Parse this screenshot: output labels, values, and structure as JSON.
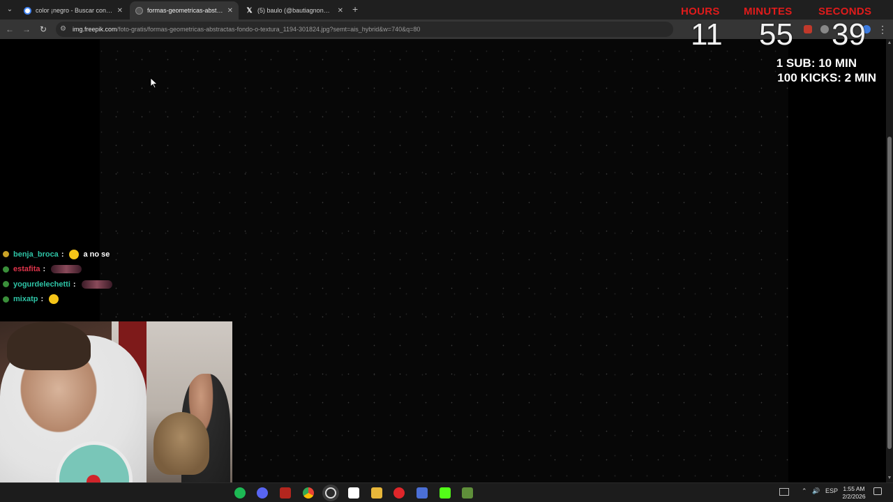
{
  "browser": {
    "tabs": [
      {
        "title": "color ¡negro - Buscar con Google",
        "favicon": "google-icon",
        "active": false
      },
      {
        "title": "formas-geometricas-abstractas-fondo-o-textura",
        "favicon": "freepik-icon",
        "active": true
      },
      {
        "title": "(5) baulo (@bautiagnone) / X",
        "favicon": "x-icon",
        "active": false
      }
    ],
    "new_tab_symbol": "+",
    "url_host": "img.freepik.com",
    "url_path": "/foto-gratis/formas-geometricas-abstractas-fondo-o-textura_1194-301824.jpg?semt=ais_hybrid&w=740&q=80",
    "nav": {
      "back": "←",
      "forward": "→",
      "reload": "↻"
    }
  },
  "stream_overlay": {
    "timer": {
      "labels": {
        "hours": "HOURS",
        "minutes": "MINUTES",
        "seconds": "SECONDS"
      },
      "hours": "11",
      "minutes": "55",
      "seconds": "39",
      "label_color": "#e11b1b"
    },
    "rules": [
      "1 SUB: 10 MIN",
      "100 KICKS: 2 MIN"
    ]
  },
  "chat": [
    {
      "user": "benja_broca",
      "color": "#2ec4a6",
      "message": "a no se",
      "emote": "smile-emote"
    },
    {
      "user": "estafita",
      "color": "#e0344b",
      "message": "",
      "emote": "wide-emote"
    },
    {
      "user": "yogurdelechetti",
      "color": "#2ec4a6",
      "message": "",
      "emote": "wide-emote"
    },
    {
      "user": "mixatp",
      "color": "#2ec4a6",
      "message": "",
      "emote": "smile-emote"
    }
  ],
  "taskbar": {
    "apps": [
      "spotify-icon",
      "discord-icon",
      "video-editor-icon",
      "chrome-icon",
      "obs-icon",
      "capcut-icon",
      "file-explorer-icon",
      "opera-gx-icon",
      "app-icon",
      "kick-icon",
      "minecraft-icon"
    ],
    "language": "ESP",
    "time": "1:55 AM",
    "date": "2/2/2026"
  }
}
